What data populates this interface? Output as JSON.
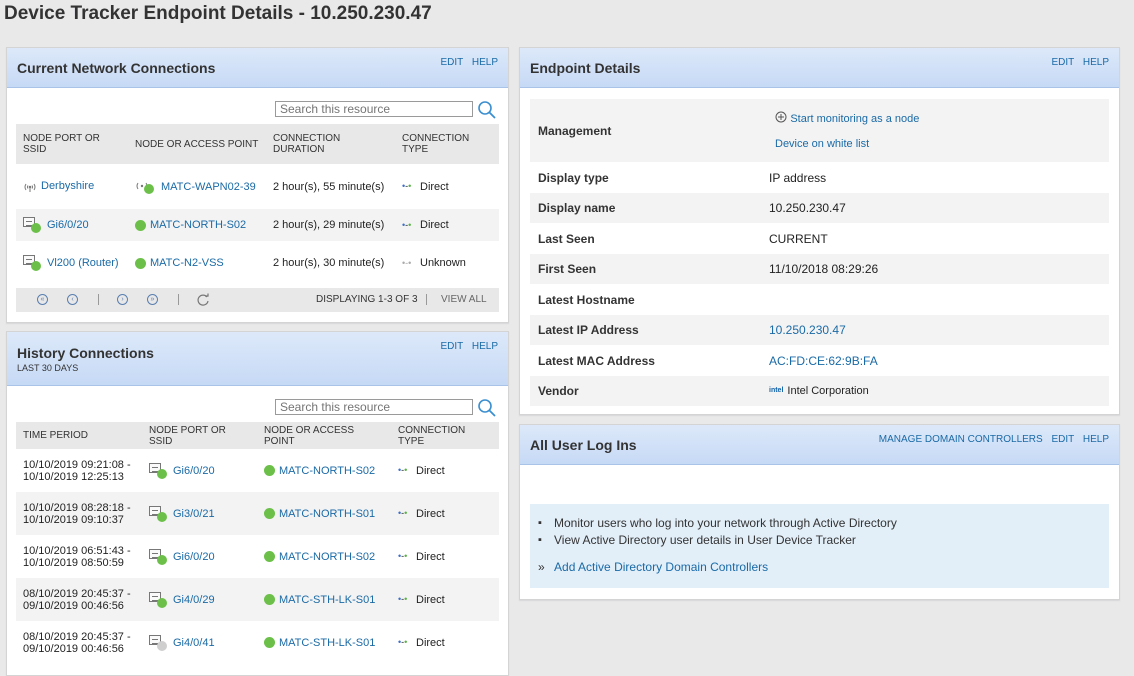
{
  "page": {
    "title": "Device Tracker Endpoint Details - 10.250.230.47"
  },
  "current_connections": {
    "title": "Current Network Connections",
    "header_links": [
      "EDIT",
      "HELP"
    ],
    "search_placeholder": "Search this resource",
    "columns": [
      "NODE PORT OR SSID",
      "NODE OR ACCESS POINT",
      "CONNECTION DURATION",
      "CONNECTION TYPE"
    ],
    "rows": [
      {
        "port": "Derbyshire",
        "node": "MATC-WAPN02-39",
        "duration": "2 hour(s), 55 minute(s)",
        "type": "Direct"
      },
      {
        "port": "Gi6/0/20",
        "node": "MATC-NORTH-S02",
        "duration": "2 hour(s), 29 minute(s)",
        "type": "Direct"
      },
      {
        "port": "Vl200 (Router)",
        "node": "MATC-N2-VSS",
        "duration": "2 hour(s), 30 minute(s)",
        "type": "Unknown"
      }
    ],
    "pager": {
      "displaying": "DISPLAYING 1-3 OF 3",
      "view_all": "VIEW ALL"
    }
  },
  "history_connections": {
    "title": "History Connections",
    "subtitle": "LAST 30 DAYS",
    "header_links": [
      "EDIT",
      "HELP"
    ],
    "search_placeholder": "Search this resource",
    "columns": [
      "TIME PERIOD",
      "NODE PORT OR SSID",
      "NODE OR ACCESS POINT",
      "CONNECTION TYPE"
    ],
    "rows": [
      {
        "start": "10/10/2019 09:21:08 -",
        "end": "10/10/2019 12:25:13",
        "port": "Gi6/0/20",
        "node": "MATC-NORTH-S02",
        "type": "Direct"
      },
      {
        "start": "10/10/2019 08:28:18 -",
        "end": "10/10/2019 09:10:37",
        "port": "Gi3/0/21",
        "node": "MATC-NORTH-S01",
        "type": "Direct"
      },
      {
        "start": "10/10/2019 06:51:43 -",
        "end": "10/10/2019 08:50:59",
        "port": "Gi6/0/20",
        "node": "MATC-NORTH-S02",
        "type": "Direct"
      },
      {
        "start": "08/10/2019 20:45:37 -",
        "end": "09/10/2019 00:46:56",
        "port": "Gi4/0/29",
        "node": "MATC-STH-LK-S01",
        "type": "Direct"
      },
      {
        "start": "08/10/2019 20:45:37 -",
        "end": "09/10/2019 00:46:56",
        "port": "Gi4/0/41",
        "node": "MATC-STH-LK-S01",
        "type": "Direct"
      }
    ]
  },
  "endpoint_details": {
    "title": "Endpoint Details",
    "header_links": [
      "EDIT",
      "HELP"
    ],
    "management_label": "Management",
    "start_monitoring": "Start monitoring as a node",
    "whitelist": "Device on white list",
    "rows": [
      {
        "key": "Display type",
        "value": "IP address"
      },
      {
        "key": "Display name",
        "value": "10.250.230.47"
      },
      {
        "key": "Last Seen",
        "value": "CURRENT"
      },
      {
        "key": "First Seen",
        "value": "11/10/2018 08:29:26"
      },
      {
        "key": "Latest Hostname",
        "value": ""
      },
      {
        "key": "Latest IP Address",
        "value": "10.250.230.47"
      },
      {
        "key": "Latest MAC Address",
        "value": "AC:FD:CE:62:9B:FA"
      },
      {
        "key": "Vendor",
        "value": "Intel Corporation",
        "vendor_logo": "intel"
      }
    ]
  },
  "user_logins": {
    "title": "All User Log Ins",
    "header_links": [
      "MANAGE DOMAIN CONTROLLERS",
      "EDIT",
      "HELP"
    ],
    "bullets": [
      "Monitor users who log into your network through Active Directory",
      "View Active Directory user details in User Device Tracker"
    ],
    "add_link": "Add Active Directory Domain Controllers",
    "add_prefix": "»"
  }
}
